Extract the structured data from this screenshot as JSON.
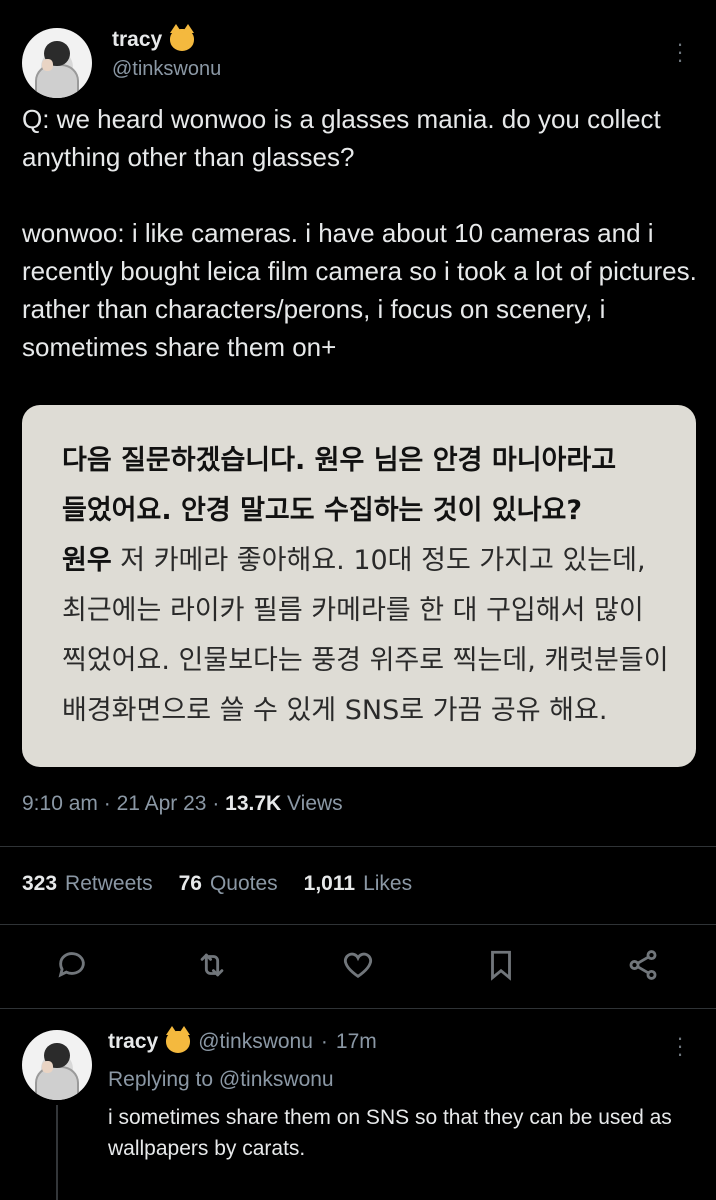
{
  "tweet": {
    "display_name": "tracy",
    "handle": "@tinkswonu",
    "text": "Q: we heard wonwoo is a glasses mania. do you collect anything other than glasses?\n\nwonwoo: i like cameras. i have about 10 cameras and i recently bought leica film camera so i took a lot of pictures. rather than characters/perons, i focus on scenery, i sometimes share them on+",
    "media_lines": [
      "다음 질문하겠습니다. 원우 님은 안경 마니아라고",
      "들었어요. 안경 말고도 수집하는 것이 있나요?",
      "원우",
      " 저 카메라 좋아해요. 10대 정도 가지고 있는데,",
      "최근에는 라이카 필름 카메라를 한 대 구입해서 많이",
      "찍었어요. 인물보다는 풍경 위주로 찍는데, 캐럿분들이",
      "배경화면으로 쓸 수 있게 SNS로 가끔 공유 해요."
    ],
    "time": "9:10 am",
    "date": "21 Apr 23",
    "views_count": "13.7K",
    "views_label": "Views",
    "retweets_count": "323",
    "retweets_label": "Retweets",
    "quotes_count": "76",
    "quotes_label": "Quotes",
    "likes_count": "1,011",
    "likes_label": "Likes"
  },
  "reply": {
    "display_name": "tracy",
    "handle": "@tinkswonu",
    "age": "17m",
    "replying_prefix": "Replying to",
    "replying_handle": "@tinkswonu",
    "text": "i sometimes share them on SNS so that they can be used as wallpapers by carats."
  },
  "icons": {
    "reply": "reply-icon",
    "retweet": "retweet-icon",
    "like": "heart-icon",
    "bookmark": "bookmark-icon",
    "share": "share-icon",
    "more": "more-icon"
  },
  "colors": {
    "background": "#000000",
    "text": "#e7e9ea",
    "secondary": "#8b98a5",
    "media_bg": "#dedcd5"
  }
}
